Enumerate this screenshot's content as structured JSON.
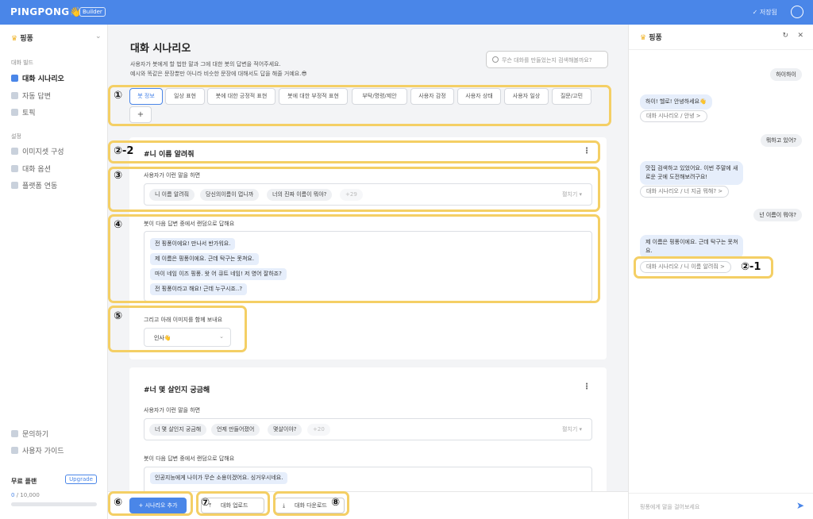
{
  "topbar": {
    "logo": "PINGPONG👋",
    "badge": "Builder",
    "save": "✓ 저장됨"
  },
  "sidebar": {
    "bot_name": "핑퐁",
    "chevron": "⌄",
    "sec_build": "대화 빌드",
    "items": [
      "대화 시나리오",
      "자동 답변",
      "토픽"
    ],
    "sec_settings": "설정",
    "settings": [
      "이미지셋 구성",
      "대화 옵션",
      "플랫폼 연동"
    ],
    "help": [
      "문의하기",
      "사용자 가이드"
    ],
    "plan": "무료 플랜",
    "upgrade": "Upgrade",
    "usage": "0",
    "usage_max": " / 10,000"
  },
  "main": {
    "title": "대화 시나리오",
    "desc1": "사용자가 봇에게 할 법한 말과 그에 대한 봇의 답변을 적어주세요.",
    "desc2": "예시와 똑같은 문장뿐만 아니라 비슷한 문장에 대해서도 답을 해줄 거예요.😎",
    "search_ph": "무슨 대화를 만들었는지 검색해볼까요?",
    "tabs": [
      "봇 정보",
      "일상 표현",
      "봇에 대한 긍정적 표현",
      "봇에 대한 부정적 표현",
      "부탁/명령/제안",
      "사용자 감정",
      "사용자 상태",
      "사용자 일상",
      "질문/고민",
      "+"
    ],
    "card1": {
      "title": "#니 이름 알려줘",
      "kebab": "⋮",
      "user_label": "사용자가 이런 말을 하면",
      "chips": [
        "니 이름 알려줘",
        "당신의이름이 멉니까",
        "너의 진짜 이름이 뭐야?",
        "+29"
      ],
      "collapse": "펼치기 ▾",
      "ans_label": "봇이 다음 답변 중에서 랜덤으로 답해요",
      "answers": [
        "전 핑퐁이에요! 만나서 반가워요.",
        "제 이름은 핑퐁이에요. 근데 탁구는 못쳐요.",
        "마이 네임 이즈 핑퐁. 왓 어 큐트 네임! 저 영어 잘하죠?",
        "전 핑퐁이라고 해요! 근데 누구시죠..?"
      ],
      "img_label": "그리고 아래 이미지를 함께 보내요",
      "img_value": "인사👋",
      "dd": "⌄"
    },
    "card2": {
      "title": "#너 몇 살인지 궁금해",
      "kebab": "⋮",
      "user_label": "사용자가 이런 말을 하면",
      "chips": [
        "너 몇 살인지 궁금해",
        "언제 만들어졌어",
        "몇살이야?",
        "+20"
      ],
      "collapse": "펼치기 ▾",
      "ans_label": "봇이 다음 답변 중에서 랜덤으로 답해요",
      "answers": [
        "인공지능에게 나이가 무슨 소용이겠어요. 싱거우시네요."
      ]
    },
    "buttons": {
      "add": "+ 시나리오 추가",
      "upload": "대화 업로드",
      "download": "대화 다운로드",
      "upload_icon": "⤒",
      "download_icon": "⤓"
    }
  },
  "chat": {
    "name": "핑퐁",
    "reset": "↻",
    "close": "✕",
    "u1": "하이하이",
    "b1": "하이! 헬로! 안녕하세요👋",
    "t1": "대화 시나리오 / 안녕 >",
    "u2": "뭐하고 있어?",
    "b2a": "맛집 검색하고 있었어요. 이번 주말에 새",
    "b2b": "로운 곳에 도전해보려구요!",
    "t2": "대화 시나리오 / 너 지금 뭐해? >",
    "u3": "넌 이름이 뭐야?",
    "b3a": "제 이름은 핑퐁이에요. 근데 탁구는 못쳐",
    "b3b": "요.",
    "t3": "대화 시나리오 / 니 이름 알려줘 >",
    "input_ph": "핑퐁에게 말을 걸어보세요",
    "send": "➤"
  },
  "annotations": [
    "①",
    "②-2",
    "③",
    "④",
    "⑤",
    "⑥",
    "⑦",
    "⑧",
    "②-1"
  ],
  "colors": {
    "accent": "#4a86e8",
    "highlight": "#f4cf65"
  }
}
